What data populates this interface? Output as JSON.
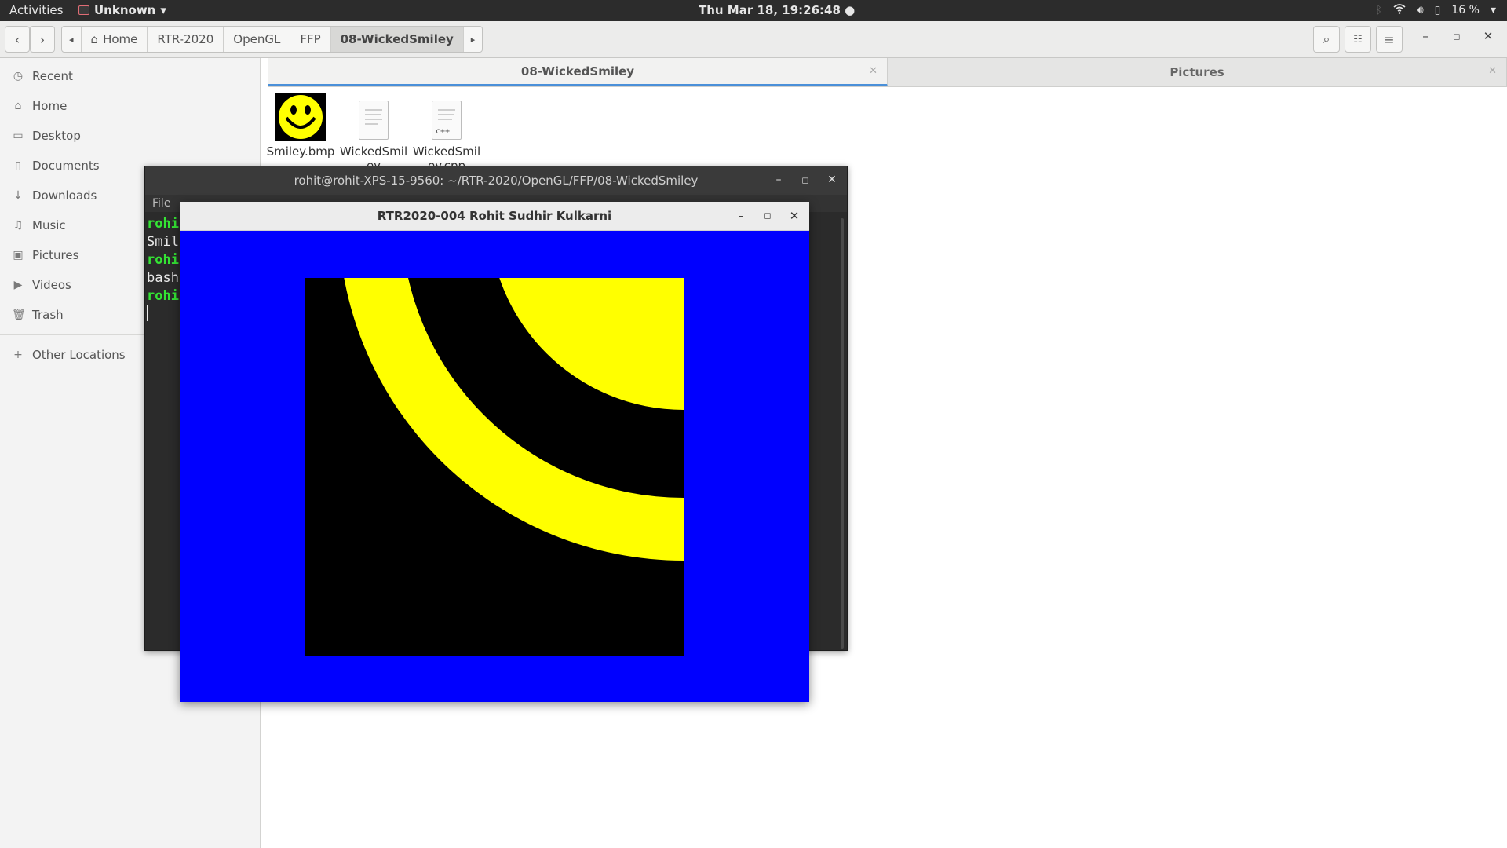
{
  "topbar": {
    "activities": "Activities",
    "app_name": "Unknown",
    "app_menu_icon": "chevron-down-icon",
    "clock": "Thu Mar 18, 19:26:48",
    "battery": "16 %",
    "tray_icons": [
      "bluetooth-icon",
      "wifi-icon",
      "volume-icon",
      "battery-icon"
    ]
  },
  "header": {
    "breadcrumbs": [
      "Home",
      "RTR-2020",
      "OpenGL",
      "FFP",
      "08-WickedSmiley"
    ],
    "active_crumb": "08-WickedSmiley",
    "buttons": [
      "back-icon",
      "forward-icon",
      "search-icon",
      "view-toggle-icon",
      "menu-icon",
      "minimize-icon",
      "maximize-icon",
      "close-icon"
    ]
  },
  "sidebar": {
    "items": [
      {
        "label": "Recent",
        "icon": "clock-icon"
      },
      {
        "label": "Home",
        "icon": "home-icon"
      },
      {
        "label": "Desktop",
        "icon": "folder-icon"
      },
      {
        "label": "Documents",
        "icon": "document-icon"
      },
      {
        "label": "Downloads",
        "icon": "download-icon"
      },
      {
        "label": "Music",
        "icon": "music-icon"
      },
      {
        "label": "Pictures",
        "icon": "image-icon"
      },
      {
        "label": "Videos",
        "icon": "video-icon"
      },
      {
        "label": "Trash",
        "icon": "trash-icon"
      }
    ],
    "other": {
      "label": "Other Locations",
      "icon": "plus-icon"
    }
  },
  "tabs": [
    {
      "label": "08-WickedSmiley",
      "active": true
    },
    {
      "label": "Pictures",
      "active": false
    }
  ],
  "files": [
    {
      "name": "Smiley.bmp",
      "type": "image"
    },
    {
      "name": "WickedSmil ey",
      "type": "text"
    },
    {
      "name": "WickedSmil ey.cpp",
      "type": "cpp"
    }
  ],
  "terminal": {
    "title": "rohit@rohit-XPS-15-9560: ~/RTR-2020/OpenGL/FFP/08-WickedSmiley",
    "menu": "File",
    "lines": [
      {
        "text": "rohi",
        "prompt": true
      },
      {
        "text": "Smil",
        "prompt": false
      },
      {
        "text": "rohi",
        "prompt": true
      },
      {
        "text": "bash",
        "prompt": false
      },
      {
        "text": "rohi",
        "prompt": true
      }
    ]
  },
  "glwindow": {
    "title": "RTR2020-004 Rohit Sudhir Kulkarni",
    "background_color": "#0000ff",
    "quad_color": "#000000",
    "stripe_color": "#ffff00"
  }
}
